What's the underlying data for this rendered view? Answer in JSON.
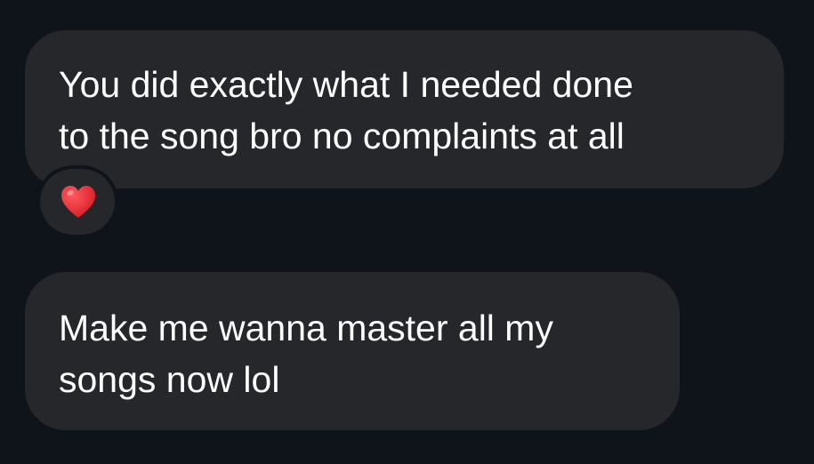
{
  "messages": [
    {
      "lines": [
        "You did exactly what I needed done",
        "to the song bro no complaints at all"
      ],
      "reaction": "heart-icon"
    },
    {
      "lines": [
        "Make me wanna master all my",
        "songs now lol"
      ]
    }
  ],
  "colors": {
    "background": "#0f131a",
    "bubble": "#25272b",
    "text": "#ffffff",
    "heart": "#e8262e"
  }
}
